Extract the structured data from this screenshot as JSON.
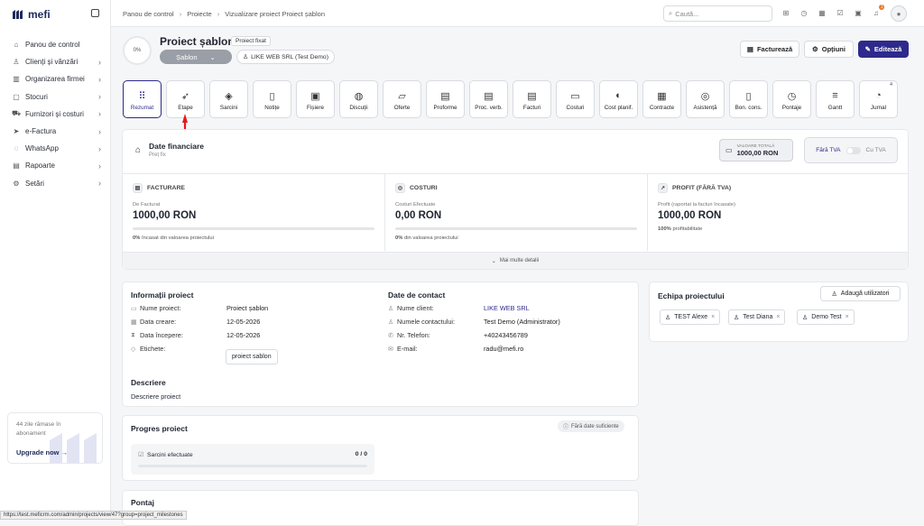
{
  "app": {
    "brand": "mefi"
  },
  "sidebar": {
    "items": [
      {
        "label": "Panou de control",
        "icon": "home-icon",
        "has_chevron": false
      },
      {
        "label": "Clienți și vânzări",
        "icon": "users-icon",
        "has_chevron": true
      },
      {
        "label": "Organizarea firmei",
        "icon": "org-icon",
        "has_chevron": true
      },
      {
        "label": "Stocuri",
        "icon": "box-icon",
        "has_chevron": true
      },
      {
        "label": "Furnizori și costuri",
        "icon": "truck-icon",
        "has_chevron": true
      },
      {
        "label": "e-Factura",
        "icon": "efactura-icon",
        "has_chevron": true
      },
      {
        "label": "WhatsApp",
        "icon": "whatsapp-icon",
        "has_chevron": true
      },
      {
        "label": "Rapoarte",
        "icon": "report-icon",
        "has_chevron": true
      },
      {
        "label": "Setări",
        "icon": "gear-icon",
        "has_chevron": true
      }
    ],
    "upgrade": {
      "text": "44 zile rămase în abonament",
      "button": "Upgrade now"
    }
  },
  "topbar": {
    "breadcrumb": [
      "Panou de control",
      "Proiecte",
      "Vizualizare proiect Proiect șablon"
    ],
    "search_placeholder": "Caută...",
    "notification_count": "1"
  },
  "project": {
    "progress": "0%",
    "title": "Proiect șablon",
    "type_badge": "Proiect fixat",
    "template_select": "Șablon",
    "client_chip": "LIKE WEB SRL (Test Demo)",
    "actions": {
      "invoice": "Facturează",
      "options": "Opțiuni",
      "edit": "Editează"
    }
  },
  "tabs": [
    {
      "label": "Rezumat",
      "icon": "grid-icon",
      "active": true
    },
    {
      "label": "Etape",
      "icon": "rocket-icon"
    },
    {
      "label": "Sarcini",
      "icon": "layers-icon"
    },
    {
      "label": "Notițe",
      "icon": "note-icon"
    },
    {
      "label": "Fișiere",
      "icon": "file-icon"
    },
    {
      "label": "Discuții",
      "icon": "chat-icon"
    },
    {
      "label": "Oferte",
      "icon": "offer-icon"
    },
    {
      "label": "Proforme",
      "icon": "proforma-icon"
    },
    {
      "label": "Proc. verb.",
      "icon": "doc-icon"
    },
    {
      "label": "Facturi",
      "icon": "invoice-icon"
    },
    {
      "label": "Costuri",
      "icon": "cost-icon"
    },
    {
      "label": "Cost planif.",
      "icon": "piggy-icon"
    },
    {
      "label": "Contracte",
      "icon": "contract-icon"
    },
    {
      "label": "Asistență",
      "icon": "support-icon"
    },
    {
      "label": "Bon. cons.",
      "icon": "receipt-icon"
    },
    {
      "label": "Pontaje",
      "icon": "clock-icon"
    },
    {
      "label": "Gantt",
      "icon": "gantt-icon"
    },
    {
      "label": "Jurnal",
      "icon": "journal-icon",
      "count": "4"
    }
  ],
  "financial": {
    "title": "Date financiare",
    "subtitle": "Preț fix",
    "total_label": "VALOARE TOTALĂ",
    "total_value": "1000,00 RON",
    "vat_off": "Fără TVA",
    "vat_on": "Cu TVA",
    "columns": [
      {
        "header": "FACTURARE",
        "sub": "De Facturat",
        "value": "1000,00 RON",
        "progress": 0,
        "footer_strong": "0%",
        "footer": "încasat din valoarea proiectului"
      },
      {
        "header": "COSTURI",
        "sub": "Costuri Efectuate",
        "value": "0,00 RON",
        "progress": 0,
        "footer_strong": "0%",
        "footer": "din valoarea proiectului"
      },
      {
        "header": "PROFIT (FĂRĂ TVA)",
        "sub": "Profit (raportat la facturi încasate)",
        "value": "1000,00 RON",
        "footer_strong": "100%",
        "footer": "profitabilitate"
      }
    ],
    "more": "Mai multe detalii"
  },
  "info": {
    "title": "Informații proiect",
    "rows": [
      {
        "label": "Nume proiect:",
        "value": "Proiect șablon"
      },
      {
        "label": "Data creare:",
        "value": "12-05-2026"
      },
      {
        "label": "Data începere:",
        "value": "12-05-2026"
      },
      {
        "label": "Etichete:",
        "value": "proiect sablon"
      }
    ],
    "contact_title": "Date de contact",
    "contact_rows": [
      {
        "label": "Nume client:",
        "value": "LIKE WEB SRL"
      },
      {
        "label": "Numele contactului:",
        "value": "Test Demo (Administrator)"
      },
      {
        "label": "Nr. Telefon:",
        "value": "+40243456789"
      },
      {
        "label": "E-mail:",
        "value": "radu@mefi.ro"
      }
    ],
    "description_title": "Descriere",
    "description": "Descriere proiect"
  },
  "team": {
    "title": "Echipa proiectului",
    "add_button": "Adaugă utilizatori",
    "members": [
      "TEST Alexe",
      "Test Diana",
      "Demo Test"
    ]
  },
  "progress_card": {
    "title": "Progres proiect",
    "badge": "Fără date suficiente",
    "tasks_label": "Sarcini efectuate",
    "tasks_value": "0 / 0"
  },
  "pontaj": {
    "title": "Pontaj"
  },
  "status_url": "https://test.meficrm.com/admin/projects/view/47?group=project_milestones"
}
